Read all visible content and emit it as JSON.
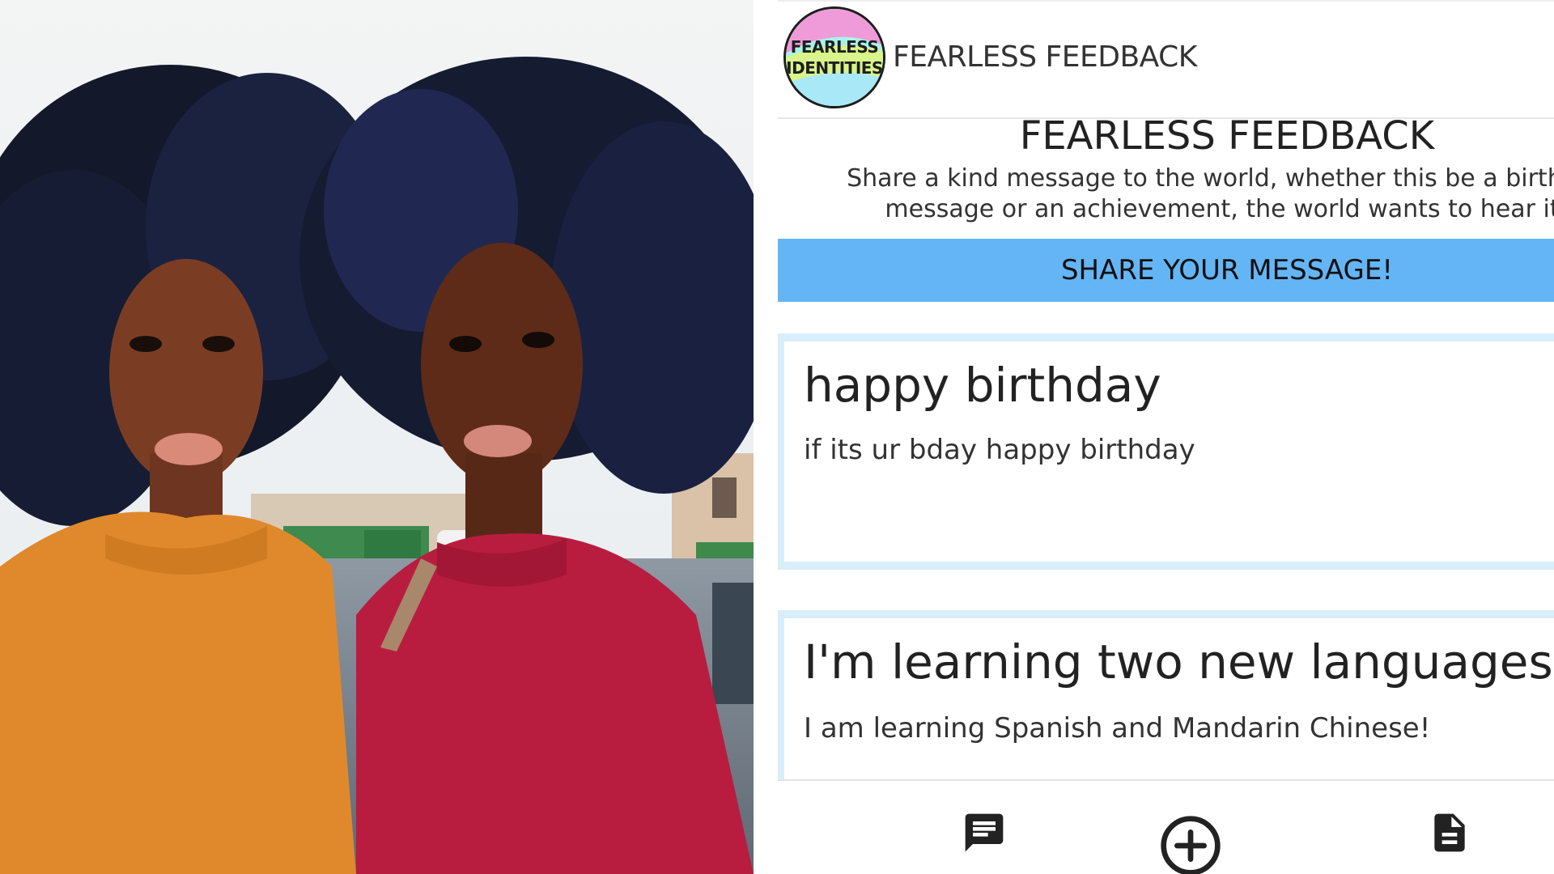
{
  "photo": {
    "description_icon": "photo-twins-icon"
  },
  "app": {
    "logo": {
      "line1": "FEARLESS",
      "line2": "IDENTITIES"
    },
    "app_title": "FEARLESS FEEDBACK",
    "headline": "FEARLESS FEEDBACK",
    "subtitle_line1": "Share a kind message to the world, whether this be a birthday",
    "subtitle_line2": "message or an achievement, the world wants to hear it!",
    "share_button_label": "SHARE YOUR MESSAGE!",
    "posts": [
      {
        "title": "happy birthday",
        "body": "if its ur bday happy birthday"
      },
      {
        "title": "I'm learning two new languages!",
        "body": "I am learning Spanish and Mandarin Chinese!"
      }
    ],
    "bottom_nav": [
      {
        "icon": "message-icon"
      },
      {
        "icon": "add-circle-icon"
      },
      {
        "icon": "document-icon"
      }
    ],
    "colors": {
      "accent_blue": "#64b5f6",
      "card_border": "#d9eefb"
    }
  }
}
